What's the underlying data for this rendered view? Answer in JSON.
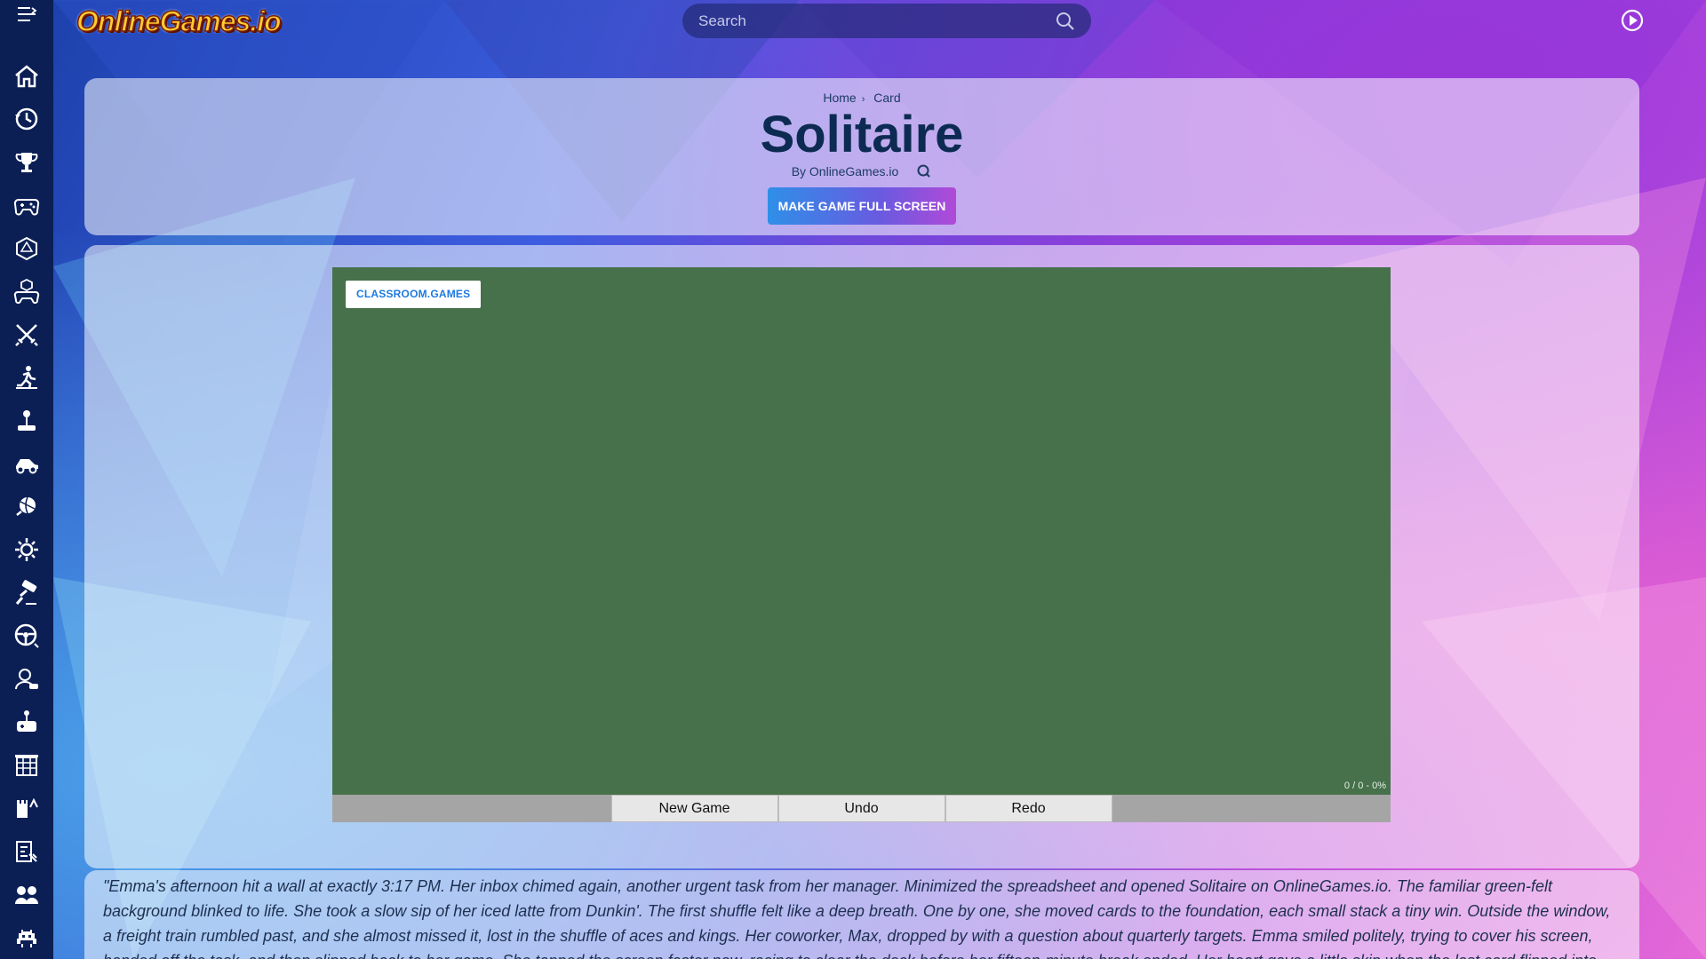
{
  "app": {
    "logo_text": "OnlineGames.io",
    "search_placeholder": "Search"
  },
  "sidebar": {
    "items": [
      {
        "icon": "home-icon"
      },
      {
        "icon": "history-icon"
      },
      {
        "icon": "trophy-icon"
      },
      {
        "icon": "gamepad-icon"
      },
      {
        "icon": "d20-dice-icon"
      },
      {
        "icon": "controller-cube-icon"
      },
      {
        "icon": "crossed-swords-icon"
      },
      {
        "icon": "runner-icon"
      },
      {
        "icon": "joystick-icon"
      },
      {
        "icon": "racing-car-icon"
      },
      {
        "icon": "basketball-icon"
      },
      {
        "icon": "gear-icon"
      },
      {
        "icon": "paint-roller-icon"
      },
      {
        "icon": "steering-wheel-icon"
      },
      {
        "icon": "avatar-gamer-icon"
      },
      {
        "icon": "arcade-icon"
      },
      {
        "icon": "building-icon"
      },
      {
        "icon": "strategy-tower-icon"
      },
      {
        "icon": "puzzle-board-icon"
      },
      {
        "icon": "two-player-icon"
      },
      {
        "icon": "space-invader-icon"
      }
    ]
  },
  "header": {
    "breadcrumb": [
      "Home",
      "Card"
    ],
    "title": "Solitaire",
    "byline": "By OnlineGames.io",
    "fullscreen_label": "MAKE GAME FULL SCREEN"
  },
  "game": {
    "classroom_label": "CLASSROOM.GAMES",
    "score_text": "0 / 0 - 0%",
    "felt_color": "#46714a",
    "controls": [
      "New Game",
      "Undo",
      "Redo"
    ]
  },
  "story": {
    "text": "\"Emma's afternoon hit a wall at exactly 3:17 PM. Her inbox chimed again, another urgent task from her manager. Minimized the spreadsheet and opened Solitaire on OnlineGames.io. The familiar green-felt background blinked to life. She took a slow sip of her iced latte from Dunkin'. The first shuffle felt like a deep breath. One by one, she moved cards to the foundation, each small stack a tiny win. Outside the window, a freight train rumbled past, and she almost missed it, lost in the shuffle of aces and kings. Her coworker, Max, dropped by with a question about quarterly targets. Emma smiled politely, trying to cover his screen, handed off the task, and then slipped back to her game. She tapped the screen faster now, racing to clear the deck before her fifteen-minute break ended. Her heart gave a little skip when the last card flipped into place. A perfect sweep. She leaned back, chest light as if she'd"
  },
  "colors": {
    "sidebar": "#0b1f55",
    "accent_blue": "#1d7ae0",
    "title": "#0d2b52"
  }
}
